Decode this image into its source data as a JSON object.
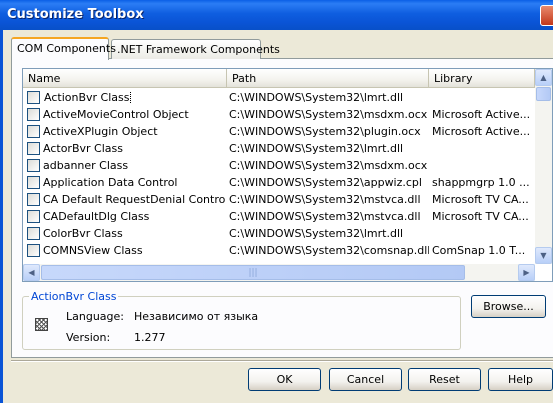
{
  "window": {
    "title": "Customize Toolbox"
  },
  "tabs": [
    {
      "label": "COM Components",
      "active": true
    },
    {
      "label": ".NET Framework Components",
      "active": false
    }
  ],
  "list": {
    "columns": [
      "Name",
      "Path",
      "Library"
    ],
    "rows": [
      {
        "checked": false,
        "name": "ActionBvr Class",
        "path": "C:\\WINDOWS\\System32\\lmrt.dll",
        "library": ""
      },
      {
        "checked": false,
        "name": "ActiveMovieControl Object",
        "path": "C:\\WINDOWS\\System32\\msdxm.ocx",
        "library": "Microsoft Active..."
      },
      {
        "checked": false,
        "name": "ActiveXPlugin Object",
        "path": "C:\\WINDOWS\\System32\\plugin.ocx",
        "library": "Microsoft Active..."
      },
      {
        "checked": false,
        "name": "ActorBvr Class",
        "path": "C:\\WINDOWS\\System32\\lmrt.dll",
        "library": ""
      },
      {
        "checked": false,
        "name": "adbanner Class",
        "path": "C:\\WINDOWS\\System32\\msdxm.ocx",
        "library": ""
      },
      {
        "checked": false,
        "name": "Application Data Control",
        "path": "C:\\WINDOWS\\System32\\appwiz.cpl",
        "library": "shappmgrp 1.0 ..."
      },
      {
        "checked": false,
        "name": "CA Default RequestDenial Control",
        "path": "C:\\WINDOWS\\System32\\mstvca.dll",
        "library": "Microsoft TV CA..."
      },
      {
        "checked": false,
        "name": "CADefaultDlg Class",
        "path": "C:\\WINDOWS\\System32\\mstvca.dll",
        "library": "Microsoft TV CA..."
      },
      {
        "checked": false,
        "name": "ColorBvr Class",
        "path": "C:\\WINDOWS\\System32\\lmrt.dll",
        "library": ""
      },
      {
        "checked": false,
        "name": "COMNSView Class",
        "path": "C:\\WINDOWS\\System32\\comsnap.dll",
        "library": "ComSnap 1.0 T..."
      }
    ],
    "selected_index": 0
  },
  "details": {
    "group_title": "ActionBvr Class",
    "language_label": "Language:",
    "language_value": "Независимо от языка",
    "version_label": "Version:",
    "version_value": "1.277"
  },
  "buttons": {
    "browse": "Browse...",
    "ok": "OK",
    "cancel": "Cancel",
    "reset": "Reset",
    "help": "Help"
  },
  "colors": {
    "title_bar": "#0a54d6",
    "dialog_bg": "#ece9d8",
    "tab_accent": "#f5a623",
    "group_title": "#0046d5"
  }
}
